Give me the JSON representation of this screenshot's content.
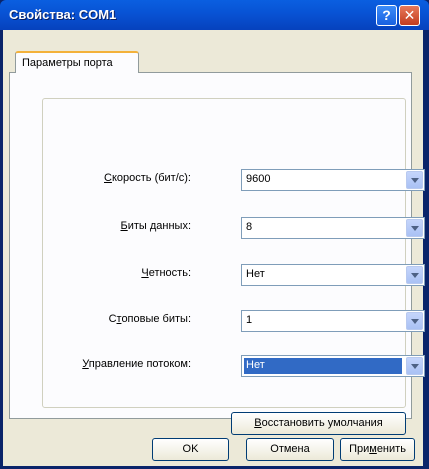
{
  "window": {
    "title": "Свойства: COM1"
  },
  "titlebar": {
    "help_glyph": "?",
    "close_glyph": "✕"
  },
  "tabs": [
    {
      "label": "Параметры порта"
    }
  ],
  "fields": [
    {
      "label_hot": "С",
      "label_rest": "корость (бит/с):",
      "value": "9600"
    },
    {
      "label_hot": "Б",
      "label_rest": "иты данных:",
      "value": "8"
    },
    {
      "label_hot": "Ч",
      "label_rest": "етность:",
      "value": "Нет"
    },
    {
      "label_pre": "С",
      "label_hot": "т",
      "label_rest": "оповые биты:",
      "value": "1"
    },
    {
      "label_hot": "У",
      "label_rest": "правление потоком:",
      "value": "Нет",
      "selected": true
    }
  ],
  "buttons": {
    "restore_hot": "В",
    "restore_rest": "осстановить умолчания",
    "ok": "OK",
    "cancel": "Отмена",
    "apply_pre": "При",
    "apply_hot": "м",
    "apply_rest": "енить"
  },
  "colors": {
    "title_bar": "#0852d4",
    "tab_highlight": "#f3b13a",
    "selection": "#316ac5",
    "face": "#ece9d8"
  }
}
